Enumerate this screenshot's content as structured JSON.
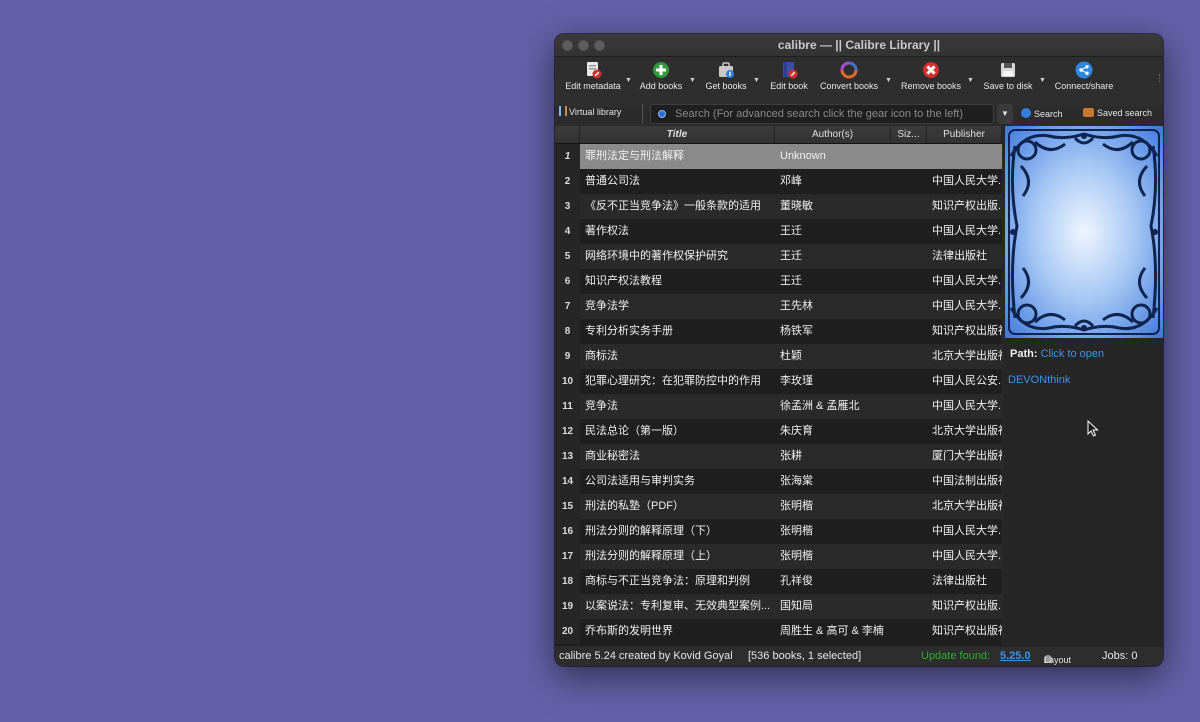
{
  "window": {
    "title": "calibre — || Calibre Library ||"
  },
  "toolbar": {
    "buttons": [
      {
        "label": "Edit metadata",
        "icon": "edit-metadata-icon"
      },
      {
        "label": "Add books",
        "icon": "add-books-icon"
      },
      {
        "label": "Get books",
        "icon": "get-books-icon"
      },
      {
        "label": "Edit book",
        "icon": "edit-book-icon"
      },
      {
        "label": "Convert books",
        "icon": "convert-books-icon"
      },
      {
        "label": "Remove books",
        "icon": "remove-books-icon"
      },
      {
        "label": "Save to disk",
        "icon": "save-to-disk-icon"
      },
      {
        "label": "Connect/share",
        "icon": "connect-share-icon"
      }
    ]
  },
  "searchbar": {
    "virtual_library": "Virtual library",
    "placeholder": "Search (For advanced search click the gear icon to the left)",
    "search_button": "Search",
    "saved_search_button": "Saved search"
  },
  "table": {
    "columns": [
      "Title",
      "Author(s)",
      "Siz...",
      "Publisher"
    ],
    "rows": [
      {
        "n": "1",
        "title": "罪刑法定与刑法解释",
        "author": "Unknown",
        "publisher": ""
      },
      {
        "n": "2",
        "title": "普通公司法",
        "author": "邓峰",
        "publisher": "中国人民大学..."
      },
      {
        "n": "3",
        "title": "《反不正当竞争法》一般条款的适用",
        "author": "董晓敏",
        "publisher": "知识产权出版..."
      },
      {
        "n": "4",
        "title": "著作权法",
        "author": "王迁",
        "publisher": "中国人民大学..."
      },
      {
        "n": "5",
        "title": "网络环境中的著作权保护研究",
        "author": "王迁",
        "publisher": "法律出版社"
      },
      {
        "n": "6",
        "title": "知识产权法教程",
        "author": "王迁",
        "publisher": "中国人民大学..."
      },
      {
        "n": "7",
        "title": "竞争法学",
        "author": "王先林",
        "publisher": "中国人民大学..."
      },
      {
        "n": "8",
        "title": "专利分析实务手册",
        "author": "杨铁军",
        "publisher": "知识产权出版社"
      },
      {
        "n": "9",
        "title": "商标法",
        "author": "杜颖",
        "publisher": "北京大学出版社"
      },
      {
        "n": "10",
        "title": "犯罪心理研究：在犯罪防控中的作用",
        "author": "李玫瑾",
        "publisher": "中国人民公安..."
      },
      {
        "n": "11",
        "title": "竞争法",
        "author": "徐孟洲 & 孟雁北",
        "publisher": "中国人民大学..."
      },
      {
        "n": "12",
        "title": "民法总论（第一版）",
        "author": "朱庆育",
        "publisher": "北京大学出版社"
      },
      {
        "n": "13",
        "title": "商业秘密法",
        "author": "张耕",
        "publisher": "厦门大学出版社"
      },
      {
        "n": "14",
        "title": "公司法适用与审判实务",
        "author": "张海棠",
        "publisher": "中国法制出版社"
      },
      {
        "n": "15",
        "title": "刑法的私塾（PDF）",
        "author": "张明楷",
        "publisher": "北京大学出版社"
      },
      {
        "n": "16",
        "title": "刑法分则的解释原理（下）",
        "author": "张明楷",
        "publisher": "中国人民大学..."
      },
      {
        "n": "17",
        "title": "刑法分则的解释原理（上）",
        "author": "张明楷",
        "publisher": "中国人民大学..."
      },
      {
        "n": "18",
        "title": "商标与不正当竞争法：原理和判例",
        "author": "孔祥俊",
        "publisher": "法律出版社"
      },
      {
        "n": "19",
        "title": "以案说法：专利复审、无效典型案例...",
        "author": "国知局",
        "publisher": "知识产权出版..."
      },
      {
        "n": "20",
        "title": "乔布斯的发明世界",
        "author": "周胜生 & 高可 & 李楠",
        "publisher": "知识产权出版社"
      }
    ]
  },
  "details": {
    "path_label": "Path:",
    "path_link": "Click to open",
    "devonthink": "DEVONthink"
  },
  "status": {
    "left": "calibre 5.24 created by Kovid Goyal",
    "books": "[536 books, 1 selected]",
    "update_label": "Update found:",
    "update_version": "5.25.0",
    "layout": "Layout",
    "jobs": "Jobs: 0"
  },
  "colors": {
    "desktop": "#6560a8",
    "link": "#3d93f0",
    "update": "#2fae2f"
  }
}
